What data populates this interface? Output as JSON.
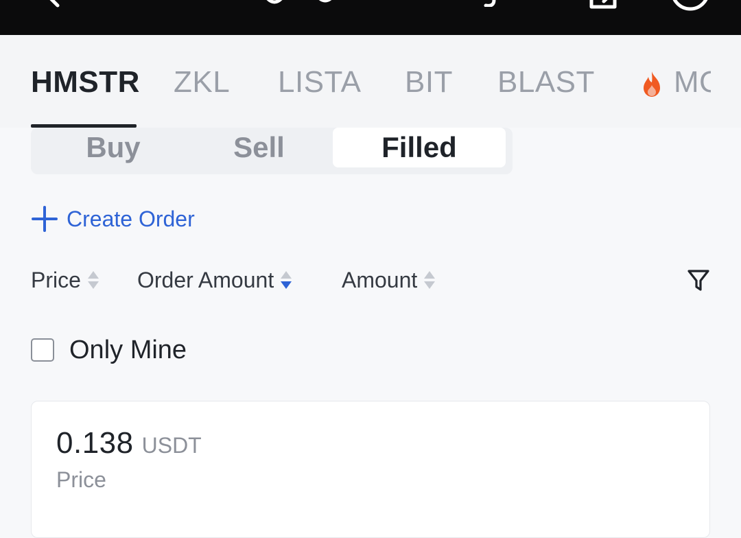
{
  "top_bar": {
    "back_icon": "chevron-left-icon",
    "edit_icon": "edit-icon",
    "clock_icon": "clock-icon"
  },
  "tickers": {
    "items": [
      {
        "label": "HMSTR",
        "active": true
      },
      {
        "label": "ZKL",
        "active": false
      },
      {
        "label": "LISTA",
        "active": false
      },
      {
        "label": "BIT",
        "active": false
      },
      {
        "label": "BLAST",
        "active": false
      },
      {
        "label": "MO",
        "active": false,
        "icon": "fire-icon"
      }
    ],
    "active_color": "#1f2329",
    "inactive_color": "#9a9fa8",
    "hot_color": "#f05a22"
  },
  "segment": {
    "items": [
      {
        "label": "Buy",
        "selected": false
      },
      {
        "label": "Sell",
        "selected": false
      },
      {
        "label": "Filled",
        "selected": true
      }
    ]
  },
  "create_order": {
    "label": "Create Order",
    "icon": "plus-icon",
    "color": "#2e63d6"
  },
  "sort": {
    "price": "Price",
    "order_amount": "Order Amount",
    "amount": "Amount",
    "active_sort": "order_amount",
    "active_direction": "descending",
    "filter_icon": "filter-icon"
  },
  "only_mine": {
    "label": "Only Mine",
    "checked": false
  },
  "card": {
    "price_value": "0.138",
    "price_unit": "USDT",
    "price_label": "Price"
  }
}
